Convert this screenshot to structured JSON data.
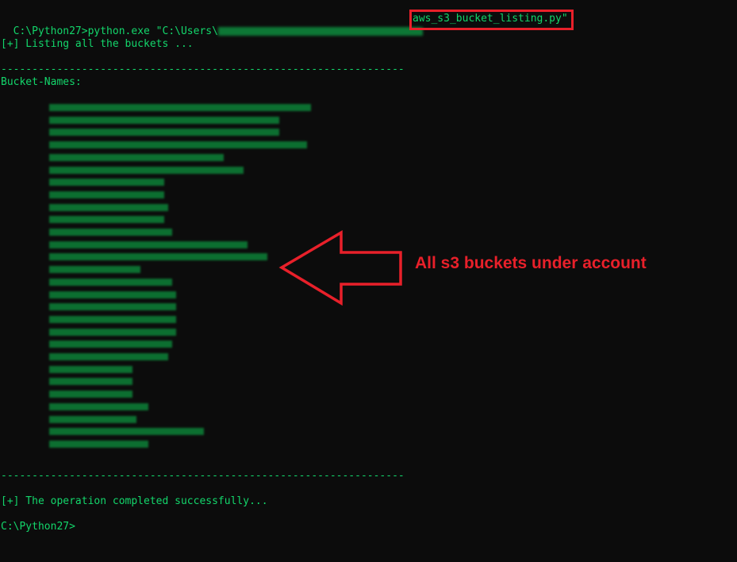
{
  "terminal": {
    "command_prefix": "C:\\Python27>python.exe \"C:\\Users\\",
    "command_file": "aws_s3_bucket_listing.py\"",
    "listing_msg": "[+] Listing all the buckets ...",
    "separator": "-----------------------------------------------------------------",
    "bucket_header": "Bucket-Names:",
    "bucket_count": 28,
    "completed_msg": "[+] The operation completed successfully...",
    "prompt": "C:\\Python27>"
  },
  "annotation": {
    "text": "All s3 buckets under account",
    "color": "#e8202a",
    "icon": "arrow-left-icon"
  },
  "colors": {
    "background": "#0c0c0c",
    "terminal_text": "#13d66b",
    "highlight": "#e8202a"
  }
}
